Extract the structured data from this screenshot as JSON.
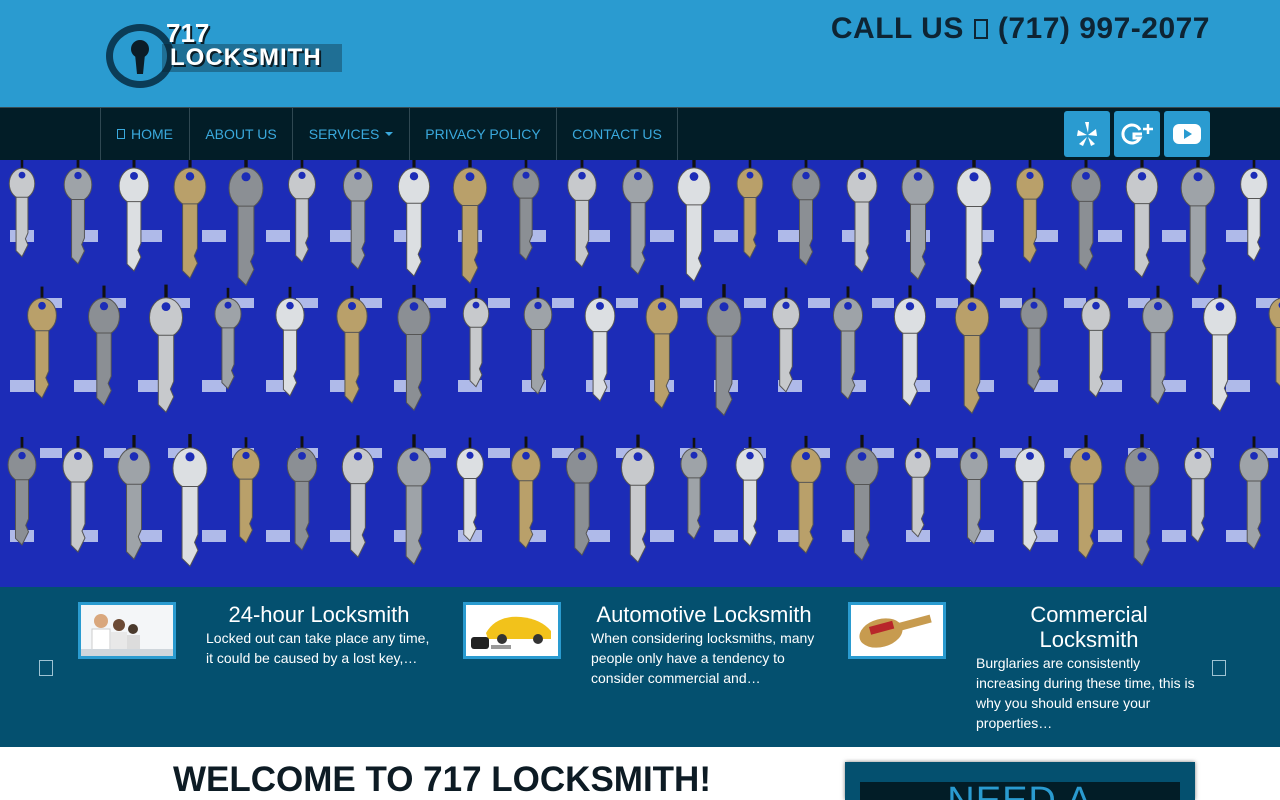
{
  "header": {
    "logo": {
      "line1": "717",
      "line2": "LOCKSMITH"
    },
    "call_label": "CALL US",
    "phone": "(717) 997-2077"
  },
  "nav": {
    "items": [
      {
        "label": "HOME",
        "icon": "home-icon"
      },
      {
        "label": "ABOUT US"
      },
      {
        "label": "SERVICES",
        "dropdown": true
      },
      {
        "label": "PRIVACY POLICY"
      },
      {
        "label": "CONTACT US"
      }
    ],
    "social": [
      {
        "name": "yelp-icon"
      },
      {
        "name": "google-plus-icon"
      },
      {
        "name": "youtube-icon"
      }
    ]
  },
  "hero": {
    "image": "wall of keys on blue board"
  },
  "services": {
    "cards": [
      {
        "title": "24-hour Locksmith",
        "text_line1": "Locked out can take place any time,",
        "text_line2": "it could be caused by a lost key,…"
      },
      {
        "title": "Automotive Locksmith",
        "text_line1": "When considering locksmiths, many",
        "text_line2": "people only have a tendency to",
        "text_line3": "consider commercial and…"
      },
      {
        "title_line1": "Commercial",
        "title_line2": "Locksmith",
        "text_line1": "Burglaries are consistently",
        "text_line2": "increasing during these time, this is",
        "text_line3": "why you should ensure your",
        "text_line4": "properties…"
      }
    ]
  },
  "welcome": {
    "title": "WELCOME TO 717 LOCKSMITH!"
  },
  "sidebar": {
    "need_title": "NEED A"
  },
  "colors": {
    "header_bg": "#2a9bd0",
    "nav_bg": "#021d27",
    "services_bg": "#04506f",
    "accent": "#3aa9dd"
  }
}
